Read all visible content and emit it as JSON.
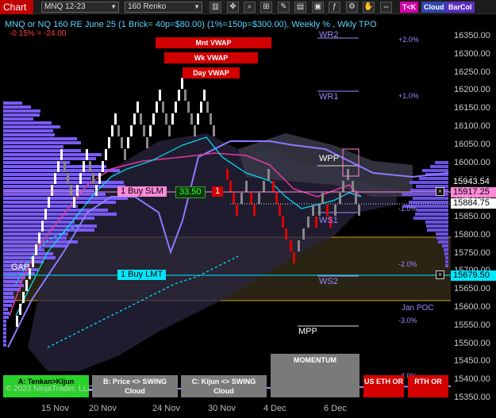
{
  "toolbar": {
    "title": "Chart",
    "instrument": "MNQ 12-23",
    "bar_type": "160 Renko",
    "btn_tk": "T<K",
    "btn_cloud": "Cloud",
    "btn_barcol": "BarCol"
  },
  "chart_header": {
    "title": "MNQ or NQ 160 RE June 25 (1 Brick= 40p=$80.00) (1%=150p=$300.00), Weekly % , Wkly TPO",
    "change": "-0.15% = -24.00"
  },
  "vwap_buttons": [
    "Mnt VWAP",
    "Wk VWAP",
    "Day VWAP"
  ],
  "levels": {
    "wr2": "WR2",
    "wr1": "WR1",
    "wpp": "WPP",
    "ws1": "WS1",
    "ws2": "WS2",
    "mpp": "MPP",
    "gap": "GAP",
    "jan_poc": "Jan POC",
    "pct_p2": "+2.0%",
    "pct_p1": "+1.0%",
    "pct_m1": "-1.0%",
    "pct_m2": "-2.0%",
    "pct_m3": "-3.0%",
    "pct_m4": "-4.0%"
  },
  "orders": {
    "buy_slm_label": "1 Buy SLM",
    "buy_slm_value": "33.50",
    "buy_slm_qty": "1",
    "buy_lmt_label": "1 Buy LMT",
    "x": "×"
  },
  "price_flags": {
    "p1": "15943.54",
    "p2": "15917.25",
    "p3": "15884.75",
    "p4": "15679.50"
  },
  "price_axis": [
    "16350.00",
    "16300.00",
    "16250.00",
    "16200.00",
    "16150.00",
    "16100.00",
    "16050.00",
    "16000.00",
    "15950.00",
    "15900.00",
    "15850.00",
    "15800.00",
    "15750.00",
    "15700.00",
    "15650.00",
    "15600.00",
    "15550.00",
    "15500.00",
    "15450.00",
    "15400.00",
    "15350.00"
  ],
  "time_axis": [
    "15 Nov",
    "20 Nov",
    "24 Nov",
    "30 Nov",
    "4 Dec",
    "6 Dec"
  ],
  "bottom_buttons": {
    "a_line1": "A: Tenkan>Kijun",
    "b_line1": "B: Price <> SWING",
    "b_line2": "Cloud",
    "c_line1": "C: Kijun <> SWING",
    "c_line2": "Cloud",
    "momentum": "MOMENTUM",
    "us_eth": "US ETH OR",
    "rth": "RTH OR"
  },
  "copyright": "© 2023 NinjaTrader, LLC",
  "colors": {
    "up_brick": "#ffffff",
    "down_brick": "#e00000",
    "tenkan_cyan": "#00e5ff",
    "kijun_purple": "#8a7bff",
    "profile_purple": "#7a5cff",
    "gap_fill": "#2a2414",
    "gap_border": "#d4a017",
    "slm_pink": "#ff8ad8",
    "lmt_cyan": "#00e8ff",
    "accent_red": "#c00000"
  }
}
